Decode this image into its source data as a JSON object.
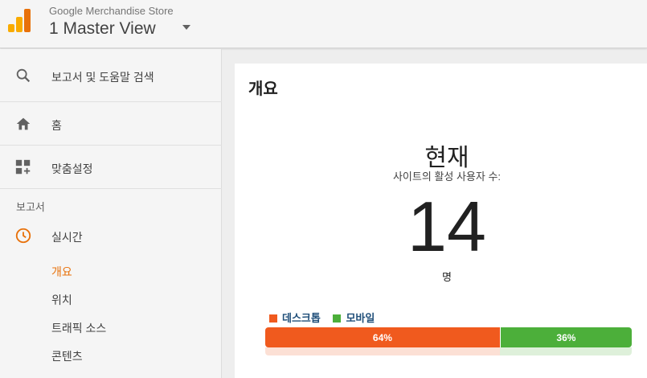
{
  "header": {
    "account": "Google Merchandise Store",
    "view": "1 Master View"
  },
  "sidebar": {
    "search_label": "보고서 및 도움말 검색",
    "home_label": "홈",
    "customization_label": "맞춤설정",
    "reports_section": "보고서",
    "realtime_label": "실시간",
    "realtime_items": [
      "개요",
      "위치",
      "트래픽 소스",
      "콘텐츠"
    ]
  },
  "main": {
    "title": "개요",
    "now_label": "현재",
    "active_users_label": "사이트의 활성 사용자 수:",
    "active_users_count": "14",
    "unit_label": "명",
    "device_split": [
      {
        "label": "데스크톱",
        "percent": 64,
        "display": "64%",
        "color": "#f05a1e"
      },
      {
        "label": "모바일",
        "percent": 36,
        "display": "36%",
        "color": "#4caf3a"
      }
    ]
  },
  "colors": {
    "accent": "#e8710a",
    "legend_text": "#1f4e79"
  }
}
